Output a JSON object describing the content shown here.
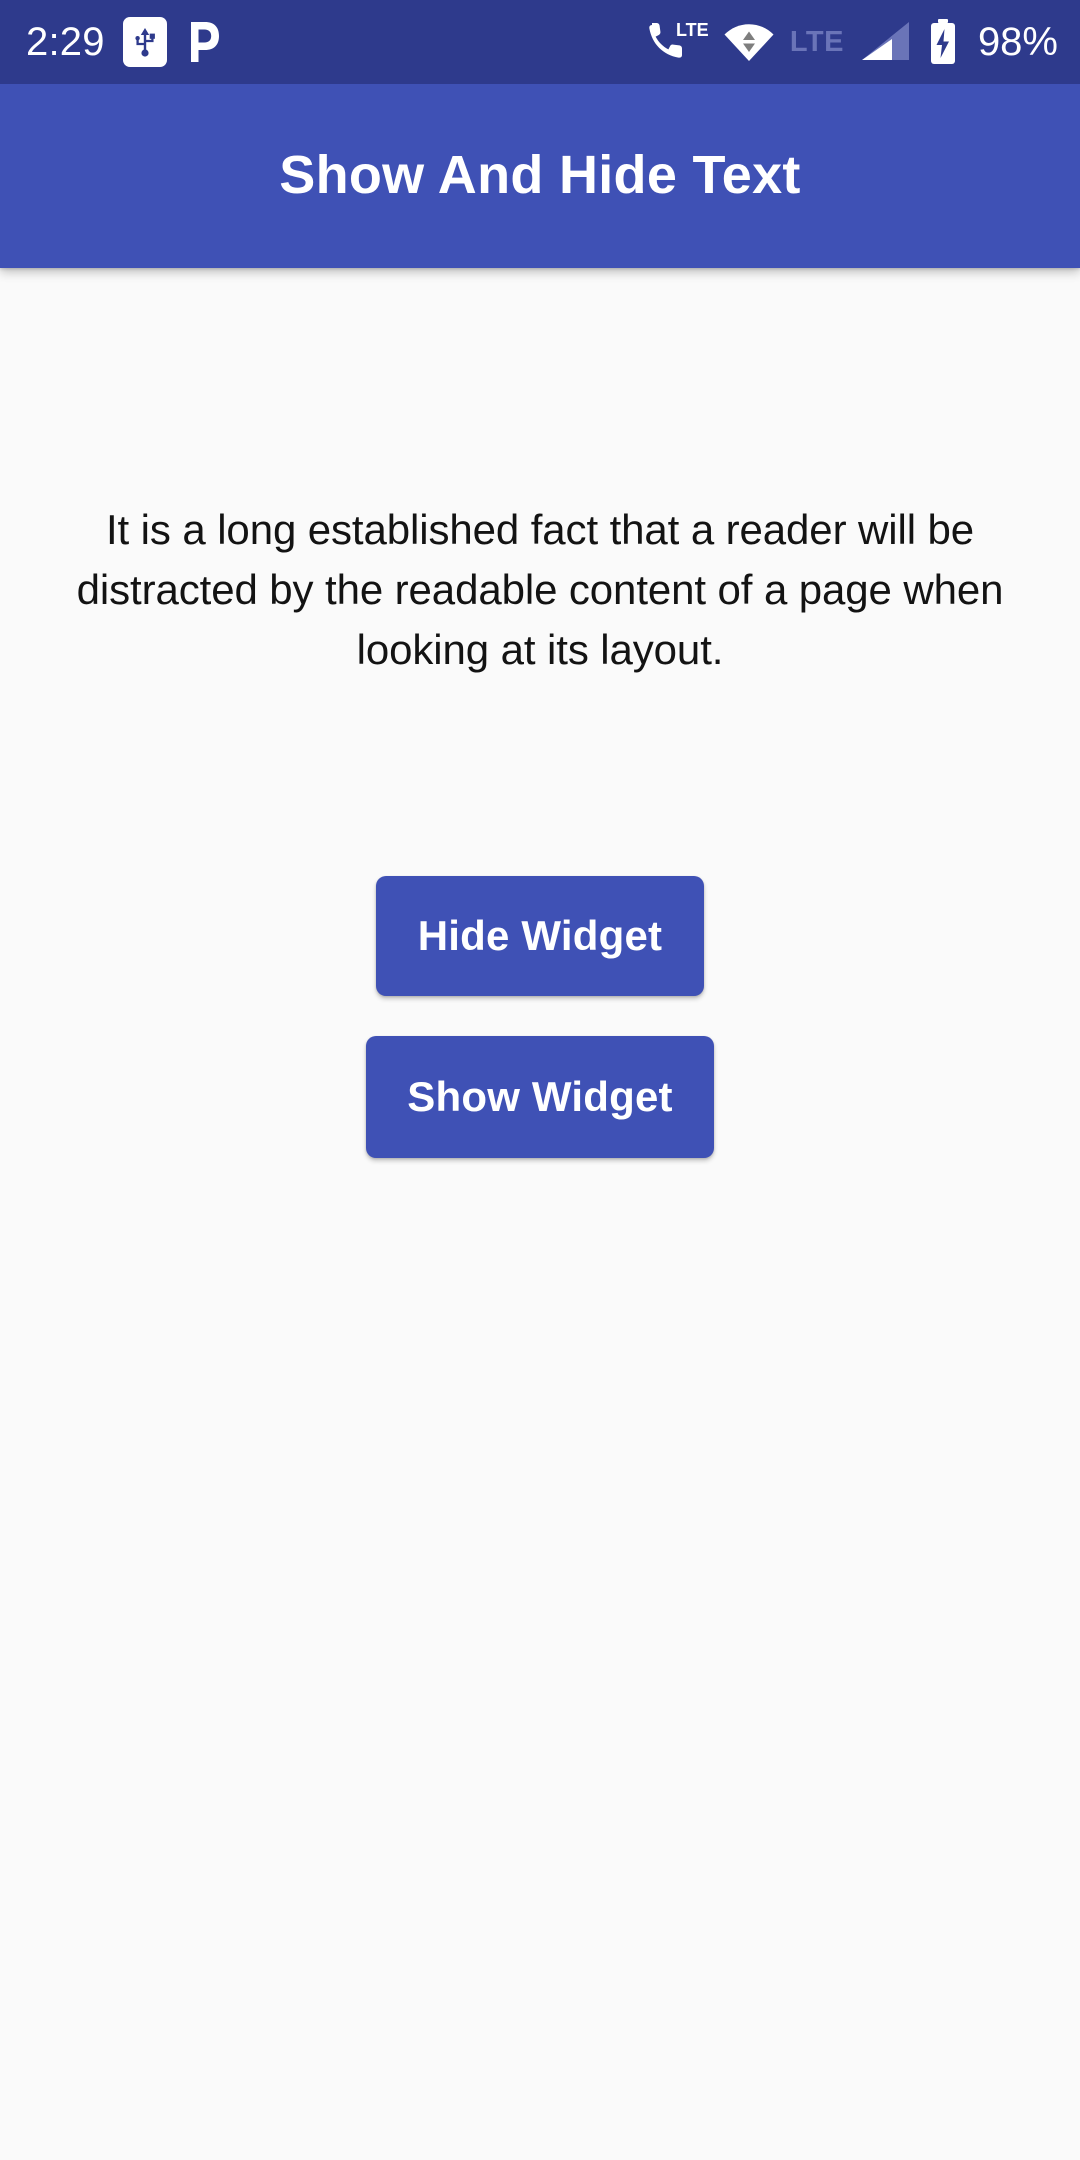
{
  "status_bar": {
    "background_color": "#2E3A8C",
    "time": "2:29",
    "left_icons": [
      {
        "name": "usb-debugging-icon",
        "label": "USB"
      },
      {
        "name": "pushbullet-p-logo-icon",
        "label": "P"
      }
    ],
    "right_icons": [
      {
        "name": "phone-lte-icon",
        "label": "LTE"
      },
      {
        "name": "wifi-transfer-icon",
        "label": "Wi-Fi"
      },
      {
        "name": "lte-network-icon",
        "label": "LTE"
      },
      {
        "name": "signal-bars-icon",
        "label": "Signal"
      },
      {
        "name": "battery-charging-icon",
        "label": "Charging"
      }
    ],
    "lte_label": "LTE",
    "battery_percent": "98%"
  },
  "app_bar": {
    "title": "Show And Hide Text",
    "background_color": "#3F51B5",
    "title_color": "#FFFFFF"
  },
  "content": {
    "background_color": "#FAFAFA",
    "paragraph": "It is a long established fact that a reader will be distracted by the readable content of a page when looking at its layout.",
    "paragraph_color": "#131313",
    "buttons": [
      {
        "label": "Hide Widget",
        "color": "#3F51B5",
        "text_color": "#FFFFFF"
      },
      {
        "label": "Show Widget",
        "color": "#3F51B5",
        "text_color": "#FFFFFF"
      }
    ]
  }
}
